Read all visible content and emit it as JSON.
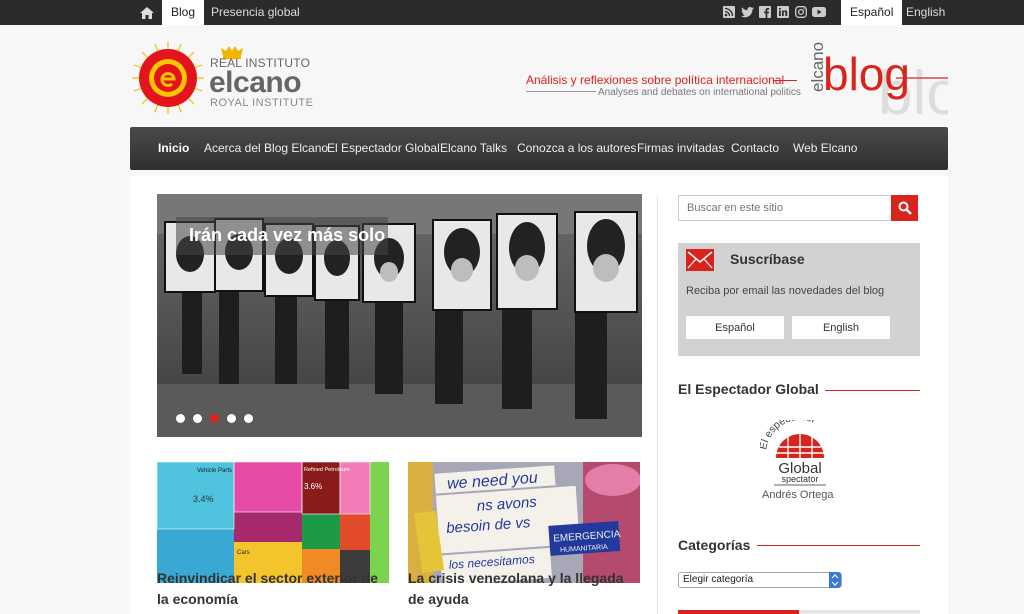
{
  "topbar": {
    "tabs": [
      {
        "label": "Blog",
        "active": true
      },
      {
        "label": "Presencia global",
        "active": false
      }
    ],
    "languages": [
      {
        "label": "Español",
        "active": true
      },
      {
        "label": "English",
        "active": false
      }
    ],
    "social_icons": [
      "rss-icon",
      "twitter-icon",
      "facebook-icon",
      "linkedin-icon",
      "instagram-icon",
      "youtube-icon"
    ]
  },
  "header": {
    "logo_line1": "REAL INSTITUTO",
    "logo_line2": "elcano",
    "logo_line3": "ROYAL INSTITUTE",
    "tagline_es": "Análisis y reflexiones sobre política internacional",
    "tagline_en": "Analyses and debates on international politics",
    "blog_small": "elcano",
    "blog_big": "blog"
  },
  "nav": {
    "items": [
      "Inicio",
      "Acerca del Blog Elcano",
      "El Espectador Global",
      "Elcano Talks",
      "Conozca a los autores",
      "Firmas invitadas",
      "Contacto",
      "Web Elcano"
    ]
  },
  "slider": {
    "title": "Irán cada vez más solo",
    "slide_count": 5,
    "active_slide": 3
  },
  "articles": [
    {
      "title": "Reinvindicar el sector exterior de la economía",
      "thumb_text": [
        "Vehicle Parts",
        "3.4%",
        "Refined Petroleum",
        "3.6%",
        "Cars"
      ]
    },
    {
      "title": "La crisis venezolana y la llegada de ayuda",
      "thumb_text": [
        "we need you",
        "ns avons",
        "besoin de vs",
        "EMERGENCIA",
        "HUMANITARIA",
        "los necesitamos"
      ]
    }
  ],
  "sidebar": {
    "search_placeholder": "Buscar en este sitio",
    "subscribe": {
      "title": "Suscríbase",
      "text": "Reciba por email las novedades del blog",
      "btn_es": "Español",
      "btn_en": "English"
    },
    "spectator_heading": "El Espectador Global",
    "spectator_logo": {
      "top": "El espectador",
      "main": "Global",
      "sub": "spectator"
    },
    "spectator_author": "Andrés Ortega",
    "categories_heading": "Categorías",
    "categories_select": "Elegir categoría"
  },
  "colors": {
    "accent": "#d7241d",
    "topbar": "#2b2b2b",
    "nav": "#3a3a3a"
  }
}
